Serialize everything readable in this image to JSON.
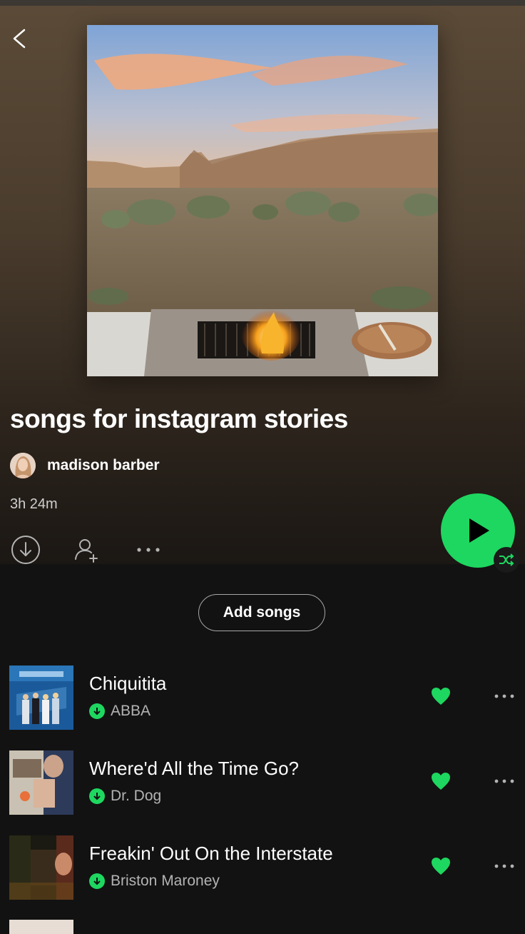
{
  "playlist": {
    "title": "songs for instagram stories",
    "owner": "madison barber",
    "duration": "3h 24m"
  },
  "icons": {
    "back": "chevron-left-icon",
    "download": "download-circle-icon",
    "add_user": "add-user-icon",
    "more": "more-horizontal-icon",
    "play": "play-icon",
    "shuffle": "shuffle-icon",
    "liked": "heart-filled-icon"
  },
  "colors": {
    "accent": "#1ed760",
    "background": "#121212",
    "header_tint": "#5b4a37"
  },
  "add_songs_label": "Add songs",
  "tracks": [
    {
      "title": "Chiquitita",
      "artist": "ABBA",
      "downloaded": true,
      "liked": true
    },
    {
      "title": "Where'd All the Time Go?",
      "artist": "Dr. Dog",
      "downloaded": true,
      "liked": true
    },
    {
      "title": "Freakin' Out On the Interstate",
      "artist": "Briston Maroney",
      "downloaded": true,
      "liked": true
    }
  ]
}
